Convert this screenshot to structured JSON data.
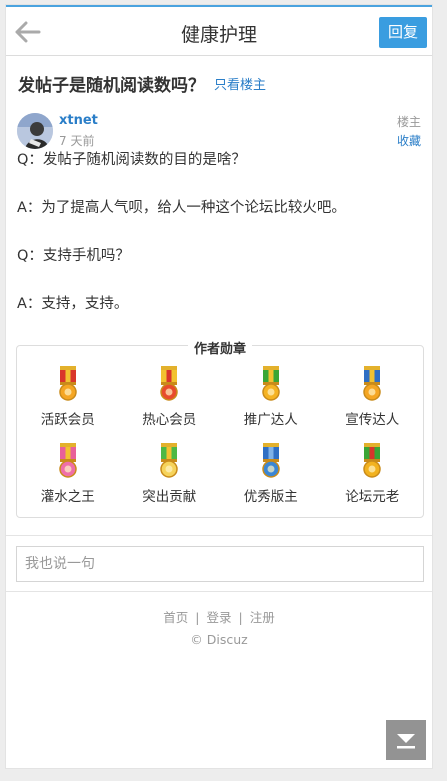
{
  "header": {
    "title": "健康护理",
    "reply_label": "回复"
  },
  "thread": {
    "title": "发帖子是随机阅读数吗？",
    "only_op_label": "只看楼主"
  },
  "post": {
    "author": "xtnet",
    "time": "7 天前",
    "floor": "楼主",
    "favorite_label": "收藏",
    "lines": [
      "Q：发帖子随机阅读数的目的是啥？",
      "A：为了提高人气呗，给人一种这个论坛比较火吧。",
      "Q：支持手机吗？",
      "A：支持，支持。"
    ]
  },
  "medals": {
    "title": "作者勋章",
    "items": [
      {
        "label": "活跃会员",
        "icon": "medal-red-gold-icon",
        "ribbon": "#d9362b",
        "stripe": "#f2c230",
        "disc": "#f5a623"
      },
      {
        "label": "热心会员",
        "icon": "medal-red-flower-icon",
        "ribbon": "#f2c230",
        "stripe": "#d9362b",
        "disc": "#e84b2c"
      },
      {
        "label": "推广达人",
        "icon": "medal-green-star-icon",
        "ribbon": "#3aa635",
        "stripe": "#f2c230",
        "disc": "#f5b323"
      },
      {
        "label": "宣传达人",
        "icon": "medal-blue-sun-icon",
        "ribbon": "#2f6fc4",
        "stripe": "#f2c230",
        "disc": "#f5a623"
      },
      {
        "label": "灌水之王",
        "icon": "medal-pink-flower-icon",
        "ribbon": "#e8609a",
        "stripe": "#f2c230",
        "disc": "#ef6fa8"
      },
      {
        "label": "突出贡献",
        "icon": "medal-green-star-outline-icon",
        "ribbon": "#4db845",
        "stripe": "#f2c230",
        "disc": "#f6d35b"
      },
      {
        "label": "优秀版主",
        "icon": "medal-blue-disc-icon",
        "ribbon": "#2f6fc4",
        "stripe": "#7fb2e8",
        "disc": "#3b86d4"
      },
      {
        "label": "论坛元老",
        "icon": "medal-green-gold-icon",
        "ribbon": "#3aa635",
        "stripe": "#d9362b",
        "disc": "#f2b21f"
      }
    ]
  },
  "reply_box": {
    "placeholder": "我也说一句"
  },
  "footer": {
    "links": [
      "首页",
      "登录",
      "注册"
    ],
    "copyright": "© Discuz"
  }
}
